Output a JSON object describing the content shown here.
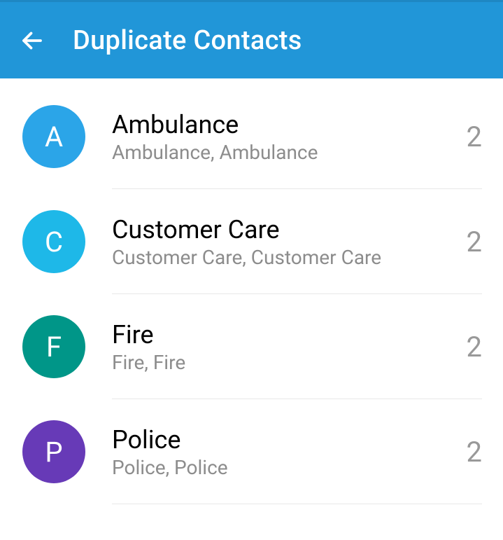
{
  "header": {
    "title": "Duplicate Contacts"
  },
  "contacts": [
    {
      "letter": "A",
      "name": "Ambulance",
      "subtitle": "Ambulance, Ambulance",
      "count": "2",
      "avatar_color": "#2ba5e8"
    },
    {
      "letter": "C",
      "name": "Customer Care",
      "subtitle": "Customer Care, Customer Care",
      "count": "2",
      "avatar_color": "#1eb8e8"
    },
    {
      "letter": "F",
      "name": "Fire",
      "subtitle": "Fire, Fire",
      "count": "2",
      "avatar_color": "#009688"
    },
    {
      "letter": "P",
      "name": "Police",
      "subtitle": "Police, Police",
      "count": "2",
      "avatar_color": "#673ab7"
    }
  ]
}
